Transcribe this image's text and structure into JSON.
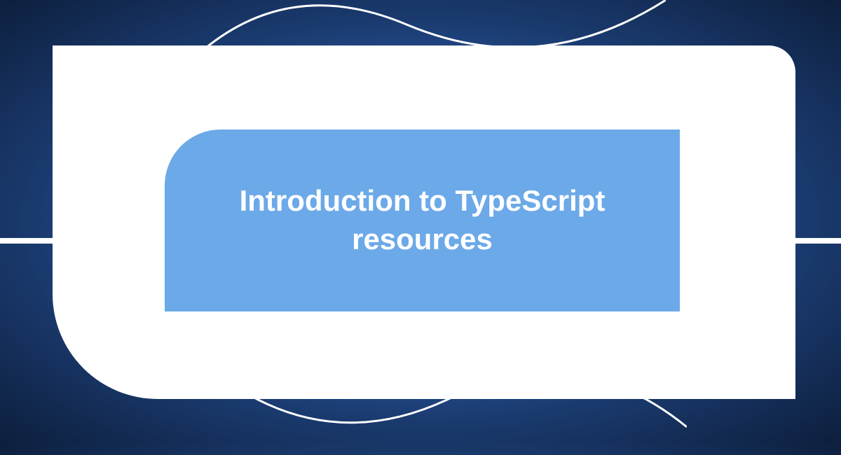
{
  "card": {
    "title": "Introduction to TypeScript resources"
  },
  "colors": {
    "inner_bg": "#6ca9e8",
    "outer_bg": "#ffffff",
    "text": "#ffffff"
  }
}
